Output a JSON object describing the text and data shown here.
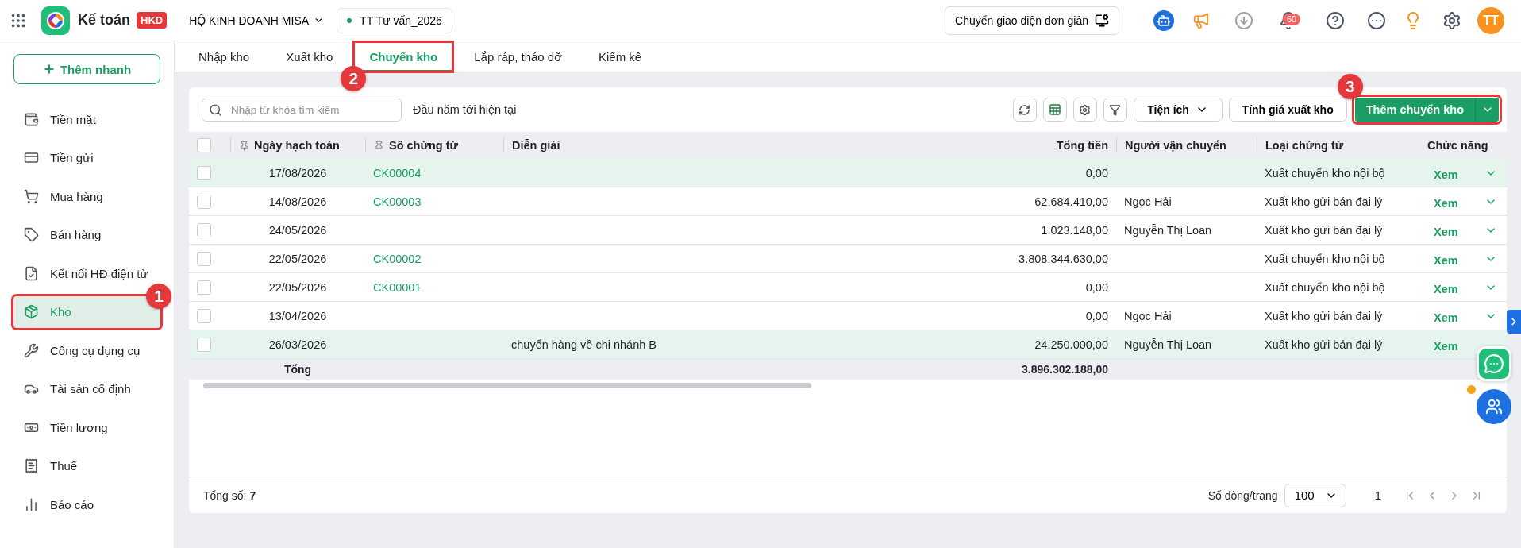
{
  "app": {
    "name": "Kế toán",
    "badge": "HKD",
    "company": "HỘ KINH DOANH MISA",
    "database": "TT Tư vấn_2026",
    "switch_button": "Chuyển giao diện đơn giản",
    "notification_count": "60",
    "avatar": "TT"
  },
  "sidebar": {
    "quick_add": "Thêm nhanh",
    "items": [
      {
        "label": "Tiền mặt",
        "selected": false
      },
      {
        "label": "Tiền gửi",
        "selected": false
      },
      {
        "label": "Mua hàng",
        "selected": false
      },
      {
        "label": "Bán hàng",
        "selected": false
      },
      {
        "label": "Kết nối HĐ điện tử",
        "selected": false
      },
      {
        "label": "Kho",
        "selected": true,
        "callout": "1"
      },
      {
        "label": "Công cụ dụng cụ",
        "selected": false
      },
      {
        "label": "Tài sản cố định",
        "selected": false
      },
      {
        "label": "Tiền lương",
        "selected": false
      },
      {
        "label": "Thuế",
        "selected": false
      },
      {
        "label": "Báo cáo",
        "selected": false
      }
    ]
  },
  "tabs": [
    {
      "label": "Nhập kho",
      "selected": false
    },
    {
      "label": "Xuất kho",
      "selected": false
    },
    {
      "label": "Chuyển kho",
      "selected": true,
      "callout": "2"
    },
    {
      "label": "Lắp ráp, tháo dỡ",
      "selected": false
    },
    {
      "label": "Kiểm kê",
      "selected": false
    }
  ],
  "toolbar": {
    "search_placeholder": "Nhập từ khóa tìm kiếm",
    "period": "Đầu năm tới hiện tại",
    "utilities": "Tiện ích",
    "cost_button": "Tính giá xuất kho",
    "add_button": "Thêm chuyển kho",
    "add_callout": "3"
  },
  "table": {
    "header_checked": false,
    "columns": [
      "Ngày hạch toán",
      "Số chứng từ",
      "Diễn giải",
      "Tổng tiền",
      "Người vận chuyển",
      "Loại chứng từ",
      "Chức năng"
    ],
    "rows": [
      {
        "date": "17/08/2026",
        "number": "CK00004",
        "total": "0,00",
        "type": "Xuất chuyển kho nội bộ",
        "action": "Xem",
        "highlighted": true,
        "checked": false,
        "menu": true
      },
      {
        "date": "14/08/2026",
        "number": "CK00003",
        "total": "62.684.410,00",
        "carrier": "Ngọc Hải",
        "type": "Xuất kho gửi bán đại lý",
        "action": "Xem",
        "highlighted": false,
        "checked": false,
        "menu": true
      },
      {
        "date": "24/05/2026",
        "total": "1.023.148,00",
        "carrier": "Nguyễn Thị Loan",
        "type": "Xuất kho gửi bán đại lý",
        "action": "Xem",
        "highlighted": false,
        "checked": false,
        "menu": true
      },
      {
        "date": "22/05/2026",
        "number": "CK00002",
        "total": "3.808.344.630,00",
        "type": "Xuất chuyển kho nội bộ",
        "action": "Xem",
        "highlighted": false,
        "checked": false,
        "menu": true
      },
      {
        "date": "22/05/2026",
        "number": "CK00001",
        "total": "0,00",
        "type": "Xuất chuyển kho nội bộ",
        "action": "Xem",
        "highlighted": false,
        "checked": false,
        "menu": true
      },
      {
        "date": "13/04/2026",
        "total": "0,00",
        "carrier": "Ngọc Hải",
        "type": "Xuất kho gửi bán đại lý",
        "action": "Xem",
        "highlighted": false,
        "checked": false,
        "menu": true
      },
      {
        "date": "26/03/2026",
        "description": "chuyển hàng về chi nhánh B",
        "total": "24.250.000,00",
        "carrier": "Nguyễn Thị Loan",
        "type": "Xuất kho gửi bán đại lý",
        "action": "Xem",
        "highlighted": true,
        "checked": false,
        "menu": false
      }
    ],
    "total_label": "Tổng",
    "total_value": "3.896.302.188,00"
  },
  "footer": {
    "count": "Tổng số: **7**",
    "rows_per_page_label": "Số dòng/trang",
    "rows_per_page": "100",
    "page": "1"
  }
}
